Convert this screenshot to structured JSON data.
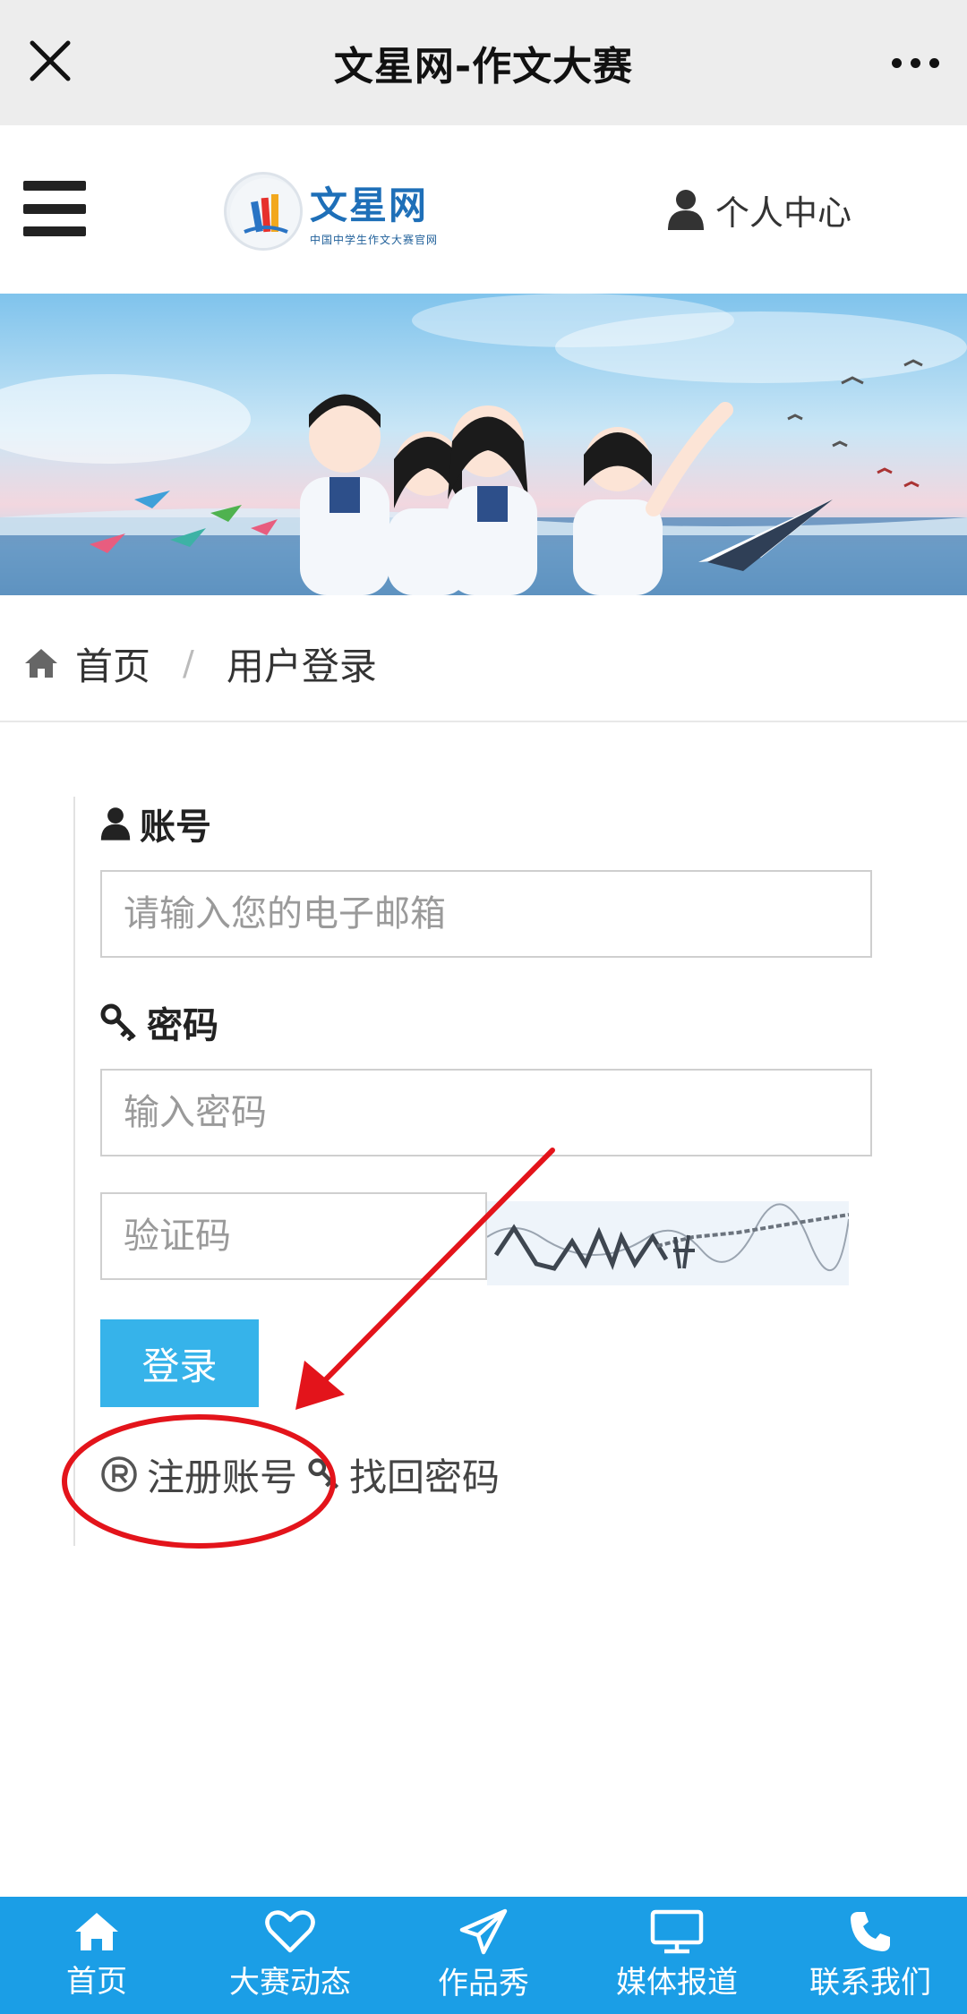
{
  "window": {
    "title": "文星网-作文大赛"
  },
  "header": {
    "logo_name": "文星网",
    "logo_sub": "中国中学生作文大赛官网",
    "user_center": "个人中心"
  },
  "breadcrumb": {
    "home": "首页",
    "separator": "/",
    "current": "用户登录"
  },
  "form": {
    "account_label": "账号",
    "account_placeholder": "请输入您的电子邮箱",
    "password_label": "密码",
    "password_placeholder": "输入密码",
    "captcha_placeholder": "验证码",
    "login_button": "登录",
    "register_link": "注册账号",
    "recover_link": "找回密码"
  },
  "bottom_nav": [
    {
      "label": "首页",
      "icon": "home-icon"
    },
    {
      "label": "大赛动态",
      "icon": "heart-icon"
    },
    {
      "label": "作品秀",
      "icon": "paper-plane-icon"
    },
    {
      "label": "媒体报道",
      "icon": "monitor-icon"
    },
    {
      "label": "联系我们",
      "icon": "phone-icon"
    }
  ],
  "colors": {
    "accent": "#36b3ea",
    "nav_bg": "#1b9ee6",
    "annotation": "#e3141b"
  }
}
